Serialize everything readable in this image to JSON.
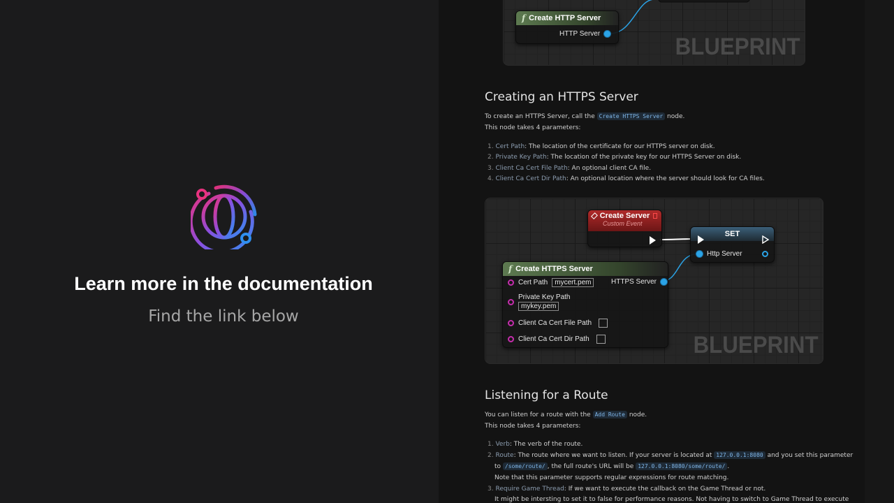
{
  "promo": {
    "title": "Learn more in the documentation",
    "subtitle": "Find the link below"
  },
  "colors": {
    "accent_gradient": [
      "#e8327f",
      "#8a4fe0",
      "#2f8ff0"
    ],
    "link": "#8c9db0",
    "code": "#7fb6e8"
  },
  "bp_top": {
    "node_title": "Create HTTP Server",
    "pin_out": "HTTP Server",
    "watermark": "BLUEPRINT"
  },
  "https": {
    "heading": "Creating an HTTPS Server",
    "intro_before": "To create an HTTPS Server, call the",
    "intro_code": "Create HTTPS Server",
    "intro_after": "node.",
    "params_line": "This node takes 4 parameters:",
    "items": [
      {
        "num": "1.",
        "key": "Cert Path",
        "text": ": The location of the certificate for our HTTPS server on disk."
      },
      {
        "num": "2.",
        "key": "Private Key Path",
        "text": ": The location of the private key for our HTTPS Server on disk."
      },
      {
        "num": "3.",
        "key": "Client Ca Cert File Path",
        "text": ": An optional client CA file."
      },
      {
        "num": "4.",
        "key": "Client Ca Cert Dir Path",
        "text": ": An optional location where the server should look for CA files."
      }
    ]
  },
  "bp_https": {
    "event_title": "Create Server",
    "event_sub": "Custom Event",
    "set_title": "SET",
    "set_pin": "Http Server",
    "node_title": "Create HTTPS Server",
    "cert_label": "Cert Path",
    "cert_value": "mycert.pem",
    "out_label": "HTTPS Server",
    "key_label": "Private Key Path",
    "key_value": "mykey.pem",
    "ca_file_label": "Client Ca Cert File Path",
    "ca_dir_label": "Client Ca Cert Dir Path",
    "watermark": "BLUEPRINT"
  },
  "route": {
    "heading": "Listening for a Route",
    "intro_before": "You can listen for a route with the",
    "intro_code": "Add Route",
    "intro_after": "node.",
    "params_line": "This node takes 4 parameters:",
    "item1": {
      "num": "1.",
      "key": "Verb",
      "text": ": The verb of the route."
    },
    "item2": {
      "num": "2.",
      "key": "Route",
      "text_a": ": The route where we want to listen. If your server is located at",
      "code_a": "127.0.0.1:8080",
      "text_b": "and you set this parameter",
      "text_c": "to",
      "code_b": "/some/route/",
      "text_d": ", the full route's URL will be",
      "code_c": "127.0.0.1:8080/some/route/",
      "text_e": ".",
      "note": "Note that this parameter supports regular expressions for route matching."
    },
    "item3": {
      "num": "3.",
      "key": "Require Game Thread",
      "text": ": If we want to execute the callback on the Game Thread or not.",
      "cont": "It might be intersting to set it to false for performance reasons. Not having to switch to Game Thread to execute"
    }
  }
}
